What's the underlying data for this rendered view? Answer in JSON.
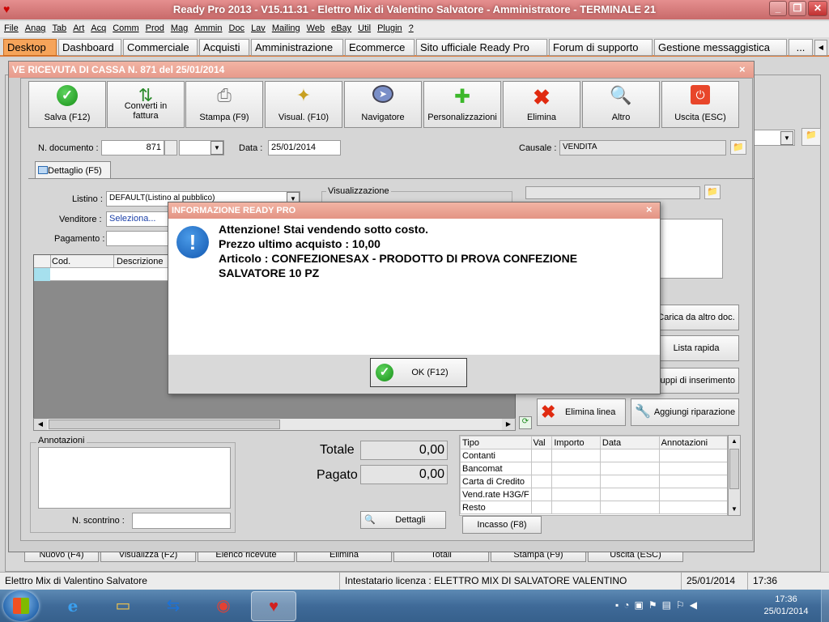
{
  "app": {
    "title": "Ready Pro 2013 - V15.11.31 - Elettro Mix di Valentino Salvatore - Amministratore - TERMINALE 21"
  },
  "menu": [
    "File",
    "Anag",
    "Tab",
    "Art",
    "Acq",
    "Comm",
    "Prod",
    "Mag",
    "Ammin",
    "Doc",
    "Lav",
    "Mailing",
    "Web",
    "eBay",
    "Util",
    "Plugin",
    "?"
  ],
  "tabs": [
    "Desktop",
    "Dashboard",
    "Commerciale",
    "Acquisti",
    "Amministrazione",
    "Ecommerce",
    "Sito ufficiale Ready Pro",
    "Forum di supporto",
    "Gestione messaggistica",
    "..."
  ],
  "subwindow": {
    "title": "VE RICEVUTA DI CASSA N. 871 del 25/01/2014",
    "toolbar": [
      {
        "label": "Salva (F12)",
        "icon": "check-icon"
      },
      {
        "label": "Converti in fattura",
        "icon": "convert-icon"
      },
      {
        "label": "Stampa (F9)",
        "icon": "printer-icon"
      },
      {
        "label": "Visual. (F10)",
        "icon": "magic-wand-icon"
      },
      {
        "label": "Navigatore",
        "icon": "compass-icon"
      },
      {
        "label": "Personalizzazioni",
        "icon": "puzzle-icon"
      },
      {
        "label": "Elimina",
        "icon": "delete-icon"
      },
      {
        "label": "Altro",
        "icon": "book-search-icon"
      },
      {
        "label": "Uscita (ESC)",
        "icon": "power-icon"
      }
    ],
    "header": {
      "ndoc_label": "N. documento :",
      "ndoc_value": "871",
      "data_label": "Data :",
      "data_value": "25/01/2014",
      "causale_label": "Causale :",
      "causale_value": "VENDITA"
    },
    "detail_tab": "Dettaglio (F5)",
    "listino_label": "Listino :",
    "listino_value": "DEFAULT(Listino al pubblico)",
    "venditore_label": "Venditore :",
    "venditore_value": "Seleziona...",
    "pagamento_label": "Pagamento :",
    "visualizzazione_label": "Visualizzazione",
    "grid_headers": [
      "Cod.",
      "Descrizione"
    ],
    "side_buttons": [
      "Carica da altro doc.",
      "Lista rapida",
      "ruppi di inserimento"
    ],
    "elimina_linea": "Elimina linea",
    "aggiungi_riparazione": "Aggiungi riparazione",
    "annotazioni_label": "Annotazioni",
    "scontrino_label": "N. scontrino :",
    "totale_label": "Totale",
    "totale_value": "0,00",
    "pagato_label": "Pagato",
    "pagato_value": "0,00",
    "dettagli_btn": "Dettagli",
    "pay_headers": [
      "Tipo",
      "Val",
      "Importo",
      "Data",
      "Annotazioni"
    ],
    "pay_rows": [
      "Contanti",
      "Bancomat",
      "Carta di Credito",
      "Vend.rate H3G/F",
      "Resto"
    ],
    "incasso_btn": "Incasso (F8)"
  },
  "bg_bottom_buttons": [
    "Nuovo (F4)",
    "Visualizza (F2)",
    "Elenco ricevute",
    "Elimina",
    "Totali",
    "Stampa (F9)",
    "Uscita (ESC)"
  ],
  "dialog": {
    "title": "INFORMAZIONE READY PRO",
    "line1": "Attenzione! Stai vendendo sotto costo.",
    "line2": "Prezzo ultimo acquisto : 10,00",
    "line3": "Articolo : CONFEZIONESAX - PRODOTTO DI PROVA CONFEZIONE",
    "line4": "SALVATORE 10 PZ",
    "ok": "OK (F12)"
  },
  "status": {
    "company": "Elettro Mix di Valentino Salvatore",
    "license": "Intestatario licenza : ELETTRO MIX DI SALVATORE VALENTINO",
    "date": "25/01/2014",
    "time": "17:36"
  },
  "taskbar": {
    "time": "17:36",
    "date": "25/01/2014",
    "apps": [
      "internet-explorer-icon",
      "file-explorer-icon",
      "teamviewer-icon",
      "chrome-icon",
      "ready-pro-icon"
    ]
  }
}
